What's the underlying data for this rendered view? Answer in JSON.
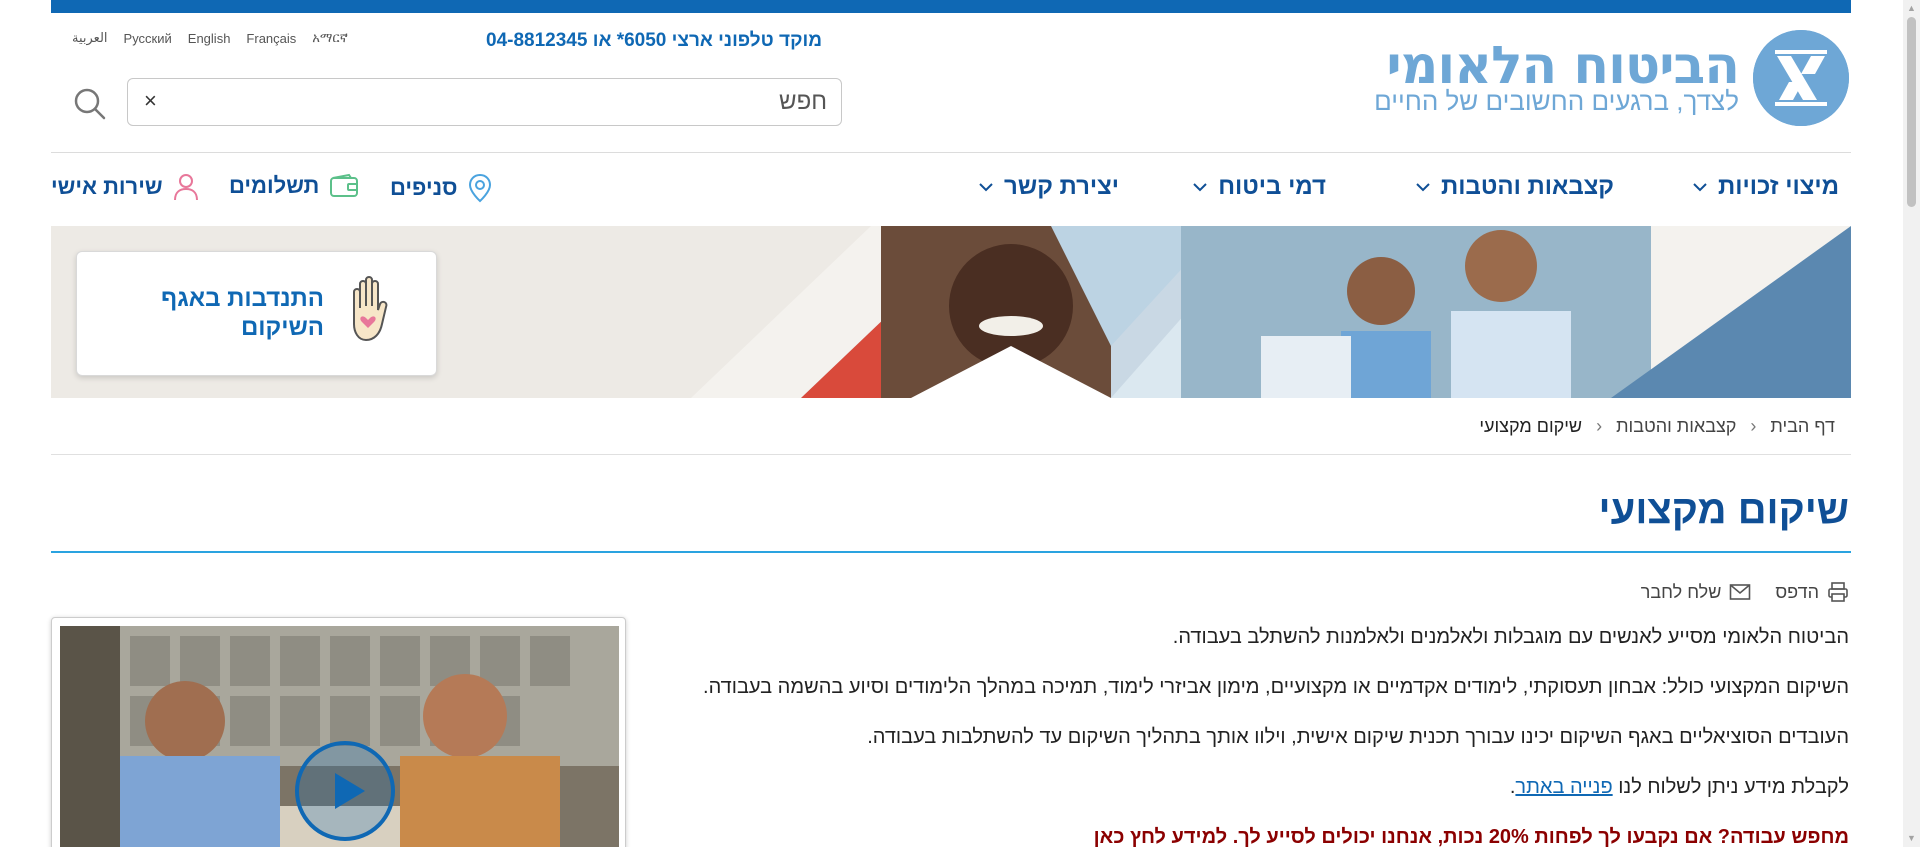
{
  "header": {
    "logo_title": "הביטוח הלאומי",
    "logo_subtitle": "לצדך, ברגעים החשובים של החיים",
    "hotline": "מוקד טלפוני ארצי 6050* או 04-8812345",
    "languages": [
      "العربية",
      "Русский",
      "English",
      "Français",
      "አማርኛ"
    ]
  },
  "search": {
    "placeholder": "חפש",
    "clear_label": "×"
  },
  "nav": {
    "items": [
      {
        "label": "מיצוי זכויות"
      },
      {
        "label": "קצבאות והטבות"
      },
      {
        "label": "דמי ביטוח"
      },
      {
        "label": "יצירת קשר"
      }
    ],
    "utilities": [
      {
        "label": "סניפים",
        "icon": "location-pin-icon"
      },
      {
        "label": "תשלומים",
        "icon": "wallet-icon"
      },
      {
        "label": "שירות אישי",
        "icon": "user-icon"
      }
    ]
  },
  "banner": {
    "volunteer_text": "התנדבות באגף השיקום"
  },
  "breadcrumb": {
    "items": [
      "דף הבית",
      "קצבאות והטבות",
      "שיקום מקצועי"
    ]
  },
  "page": {
    "title": "שיקום מקצועי",
    "actions": {
      "print": "הדפס",
      "send": "שלח לחבר"
    },
    "paragraphs": [
      "הביטוח הלאומי מסייע לאנשים עם מוגבלות ולאלמנים ולאלמנות להשתלב בעבודה.",
      "השיקום המקצועי כולל: אבחון תעסוקתי, לימודים אקדמיים או מקצועיים, מימון אביזרי לימוד, תמיכה במהלך הלימודים וסיוע בהשמה בעבודה.",
      "העובדים הסוציאליים באגף השיקום יכינו עבורך תכנית שיקום אישית, וילוו אותך בתהליך השיקום עד להשתלבות בעבודה."
    ],
    "contact_prefix": "לקבלת מידע ניתן לשלוח לנו ",
    "contact_link": "פנייה באתר",
    "contact_suffix": ".",
    "highlight": "מחפש עבודה? אם נקבעו לך לפחות 20% נכות, אנחנו יכולים לסייע לך. למידע לחץ כאן"
  },
  "colors": {
    "brand_blue": "#0f68b4",
    "logo_blue": "#6ea7d6",
    "nav_blue": "#0f4f96",
    "accent_rule": "#2aa3e0",
    "highlight_red": "#8b0000"
  }
}
